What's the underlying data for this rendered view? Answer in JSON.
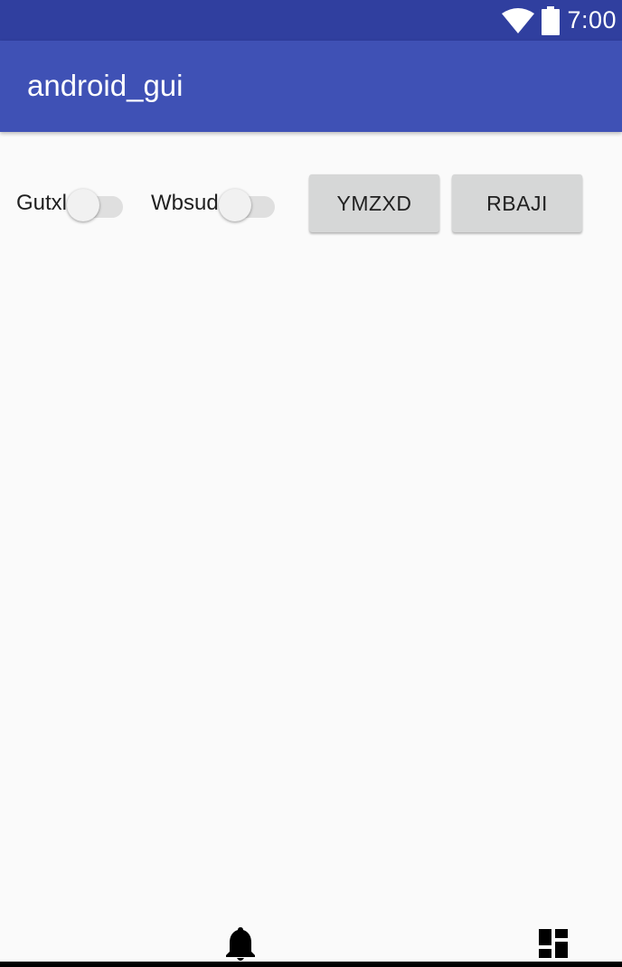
{
  "status_bar": {
    "time": "7:00",
    "icons": [
      "wifi-icon",
      "battery-icon"
    ],
    "background": "#303f9f"
  },
  "app_bar": {
    "title": "android_gui",
    "background": "#3f51b5"
  },
  "controls": {
    "switch_1": {
      "label": "Gutxl",
      "checked": false
    },
    "switch_2": {
      "label": "Wbsud",
      "checked": false
    },
    "button_1": {
      "label": "YMZXD"
    },
    "button_2": {
      "label": "RBAJI"
    }
  },
  "bottom_icons": [
    "bell-icon",
    "dashboard-icon"
  ],
  "colors": {
    "content_background": "#fafafa",
    "button_background": "#d6d7d7",
    "text": "#212121"
  }
}
